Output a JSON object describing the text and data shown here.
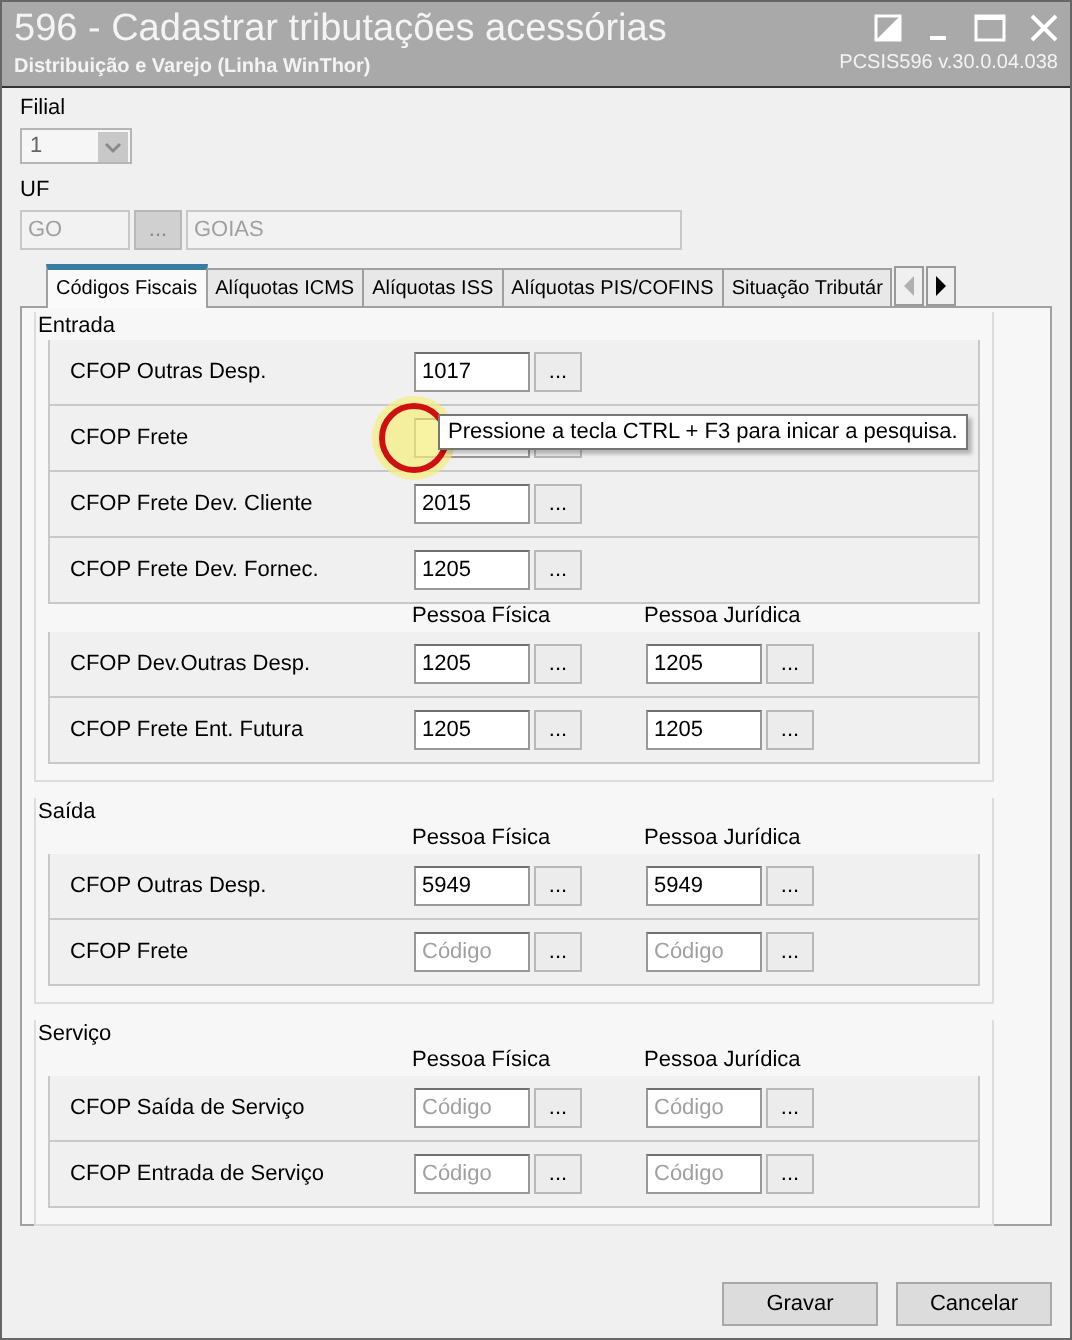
{
  "window": {
    "title": "596 - Cadastrar tributações acessórias",
    "subtitle": "Distribuição e Varejo (Linha WinThor)",
    "version": "PCSIS596  v.30.0.04.038"
  },
  "filial": {
    "label": "Filial",
    "value": "1",
    "disabled": true
  },
  "uf": {
    "label": "UF",
    "code": "GO",
    "button": "...",
    "name": "GOIAS",
    "disabled": true
  },
  "tabs": [
    {
      "label": "Códigos Fiscais",
      "selected": true
    },
    {
      "label": "Alíquotas ICMS",
      "selected": false
    },
    {
      "label": "Alíquotas ISS",
      "selected": false
    },
    {
      "label": "Alíquotas PIS/COFINS",
      "selected": false
    },
    {
      "label": "Situação Tributár",
      "selected": false
    }
  ],
  "tab_scroll": {
    "left_disabled": true,
    "right_disabled": false
  },
  "groups": [
    {
      "title": "Entrada",
      "blocks": [
        {
          "rows": [
            {
              "label": "CFOP Outras Desp.",
              "fields": [
                {
                  "value": "1017",
                  "button": "..."
                }
              ]
            },
            {
              "label": "CFOP Frete",
              "tooltip": "Pressione a tecla CTRL + F3 para inicar a pesquisa.",
              "highlight": true
            },
            {
              "label": "CFOP Frete Dev. Cliente",
              "fields": [
                {
                  "value": "2015",
                  "button": "..."
                }
              ]
            },
            {
              "label": "CFOP Frete Dev. Fornec.",
              "fields": [
                {
                  "value": "1205",
                  "button": "..."
                }
              ]
            }
          ]
        },
        {
          "headers": [
            "Pessoa Física",
            "Pessoa Jurídica"
          ],
          "rows": [
            {
              "label": "CFOP Dev.Outras Desp.",
              "fields": [
                {
                  "value": "1205",
                  "button": "..."
                },
                {
                  "value": "1205",
                  "button": "..."
                }
              ]
            },
            {
              "label": "CFOP Frete Ent. Futura",
              "fields": [
                {
                  "value": "1205",
                  "button": "..."
                },
                {
                  "value": "1205",
                  "button": "..."
                }
              ]
            }
          ]
        }
      ]
    },
    {
      "title": "Saída",
      "blocks": [
        {
          "headers": [
            "Pessoa Física",
            "Pessoa Jurídica"
          ],
          "rows": [
            {
              "label": "CFOP Outras Desp.",
              "fields": [
                {
                  "value": "5949",
                  "button": "..."
                },
                {
                  "value": "5949",
                  "button": "..."
                }
              ]
            },
            {
              "label": "CFOP Frete",
              "fields": [
                {
                  "placeholder": "Código",
                  "button": "..."
                },
                {
                  "placeholder": "Código",
                  "button": "..."
                }
              ]
            }
          ]
        }
      ]
    },
    {
      "title": "Serviço",
      "blocks": [
        {
          "headers": [
            "Pessoa Física",
            "Pessoa Jurídica"
          ],
          "rows": [
            {
              "label": "CFOP Saída de Serviço",
              "fields": [
                {
                  "placeholder": "Código",
                  "button": "..."
                },
                {
                  "placeholder": "Código",
                  "button": "..."
                }
              ]
            },
            {
              "label": "CFOP Entrada de Serviço",
              "fields": [
                {
                  "placeholder": "Código",
                  "button": "..."
                },
                {
                  "placeholder": "Código",
                  "button": "..."
                }
              ]
            }
          ]
        }
      ]
    }
  ],
  "buttons": [
    "Gravar",
    "Cancelar"
  ]
}
